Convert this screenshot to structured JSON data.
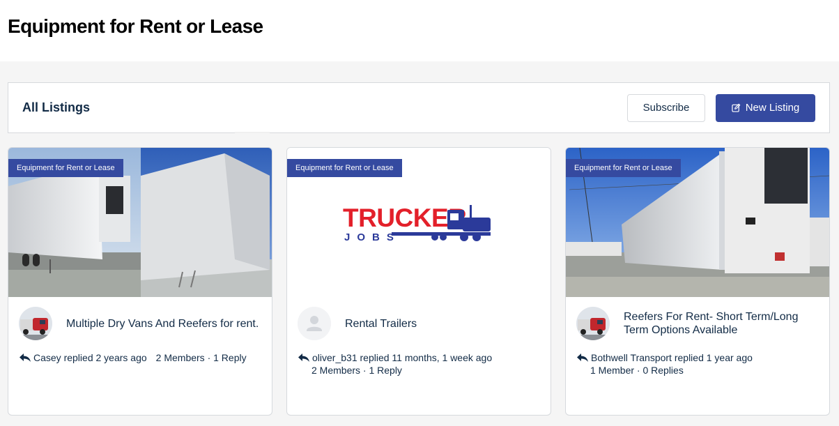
{
  "page": {
    "title": "Equipment for Rent or Lease"
  },
  "bar": {
    "title": "All Listings",
    "subscribe_label": "Subscribe",
    "new_listing_label": "New Listing"
  },
  "cards": [
    {
      "tag": "Equipment for Rent or Lease",
      "title": "Multiple Dry Vans And Reefers for rent.",
      "replier": "Casey replied 2 years ago",
      "stats": "2 Members · 1 Reply"
    },
    {
      "tag": "Equipment for Rent or Lease",
      "logo_main": "TRUCKER",
      "logo_sub": "JOBS",
      "title": "Rental Trailers",
      "replier": "oliver_b31 replied 11 months, 1 week ago",
      "stats": "2 Members · 1 Reply"
    },
    {
      "tag": "Equipment for Rent or Lease",
      "title": "Reefers For Rent- Short Term/Long Term Options Available",
      "replier": "Bothwell Transport replied 1 year ago",
      "stats": "1 Member · 0 Replies"
    }
  ],
  "colors": {
    "accent": "#354aa0",
    "text": "#122b46",
    "logo_red": "#e3202a",
    "logo_blue": "#2b3a9a"
  },
  "icons": [
    "edit-icon",
    "reply-icon",
    "default-avatar-icon",
    "truck-icon"
  ]
}
